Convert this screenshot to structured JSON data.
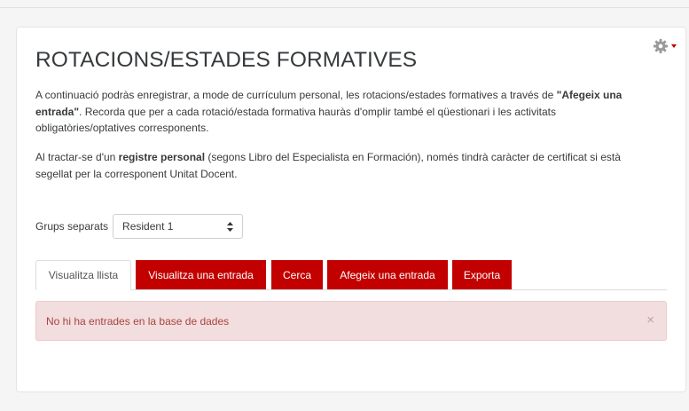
{
  "page": {
    "title": "ROTACIONS/ESTADES FORMATIVES"
  },
  "intro": {
    "p1_pre": "A continuació podràs enregistrar, a mode de currículum personal, les rotacions/estades formatives a través de ",
    "p1_bold": "\"Afegeix una entrada\"",
    "p1_post": ". Recorda que per a cada rotació/estada formativa hauràs d'omplir també el qüestionari i les activitats obligatòries/optatives corresponents.",
    "p2_pre": "Al tractar-se d'un ",
    "p2_bold": "registre personal",
    "p2_post": " (segons Libro del Especialista en Formación), només tindrà caràcter de certificat si està segellat per la corresponent Unitat Docent."
  },
  "groups": {
    "label": "Grups separats",
    "selected": "Resident 1"
  },
  "tabs": [
    {
      "label": "Visualitza llista",
      "active": true
    },
    {
      "label": "Visualitza una entrada",
      "active": false
    },
    {
      "label": "Cerca",
      "active": false
    },
    {
      "label": "Afegeix una entrada",
      "active": false
    },
    {
      "label": "Exporta",
      "active": false
    }
  ],
  "alert": {
    "message": "No hi ha entrades en la base de dades",
    "close": "×"
  },
  "icons": {
    "settings": "gear-icon",
    "settings_menu": "caret-down-icon",
    "select_arrows": "updown-arrows-icon"
  },
  "colors": {
    "accent": "#c20000",
    "alert_bg": "#f2dede",
    "alert_text": "#a94442"
  }
}
